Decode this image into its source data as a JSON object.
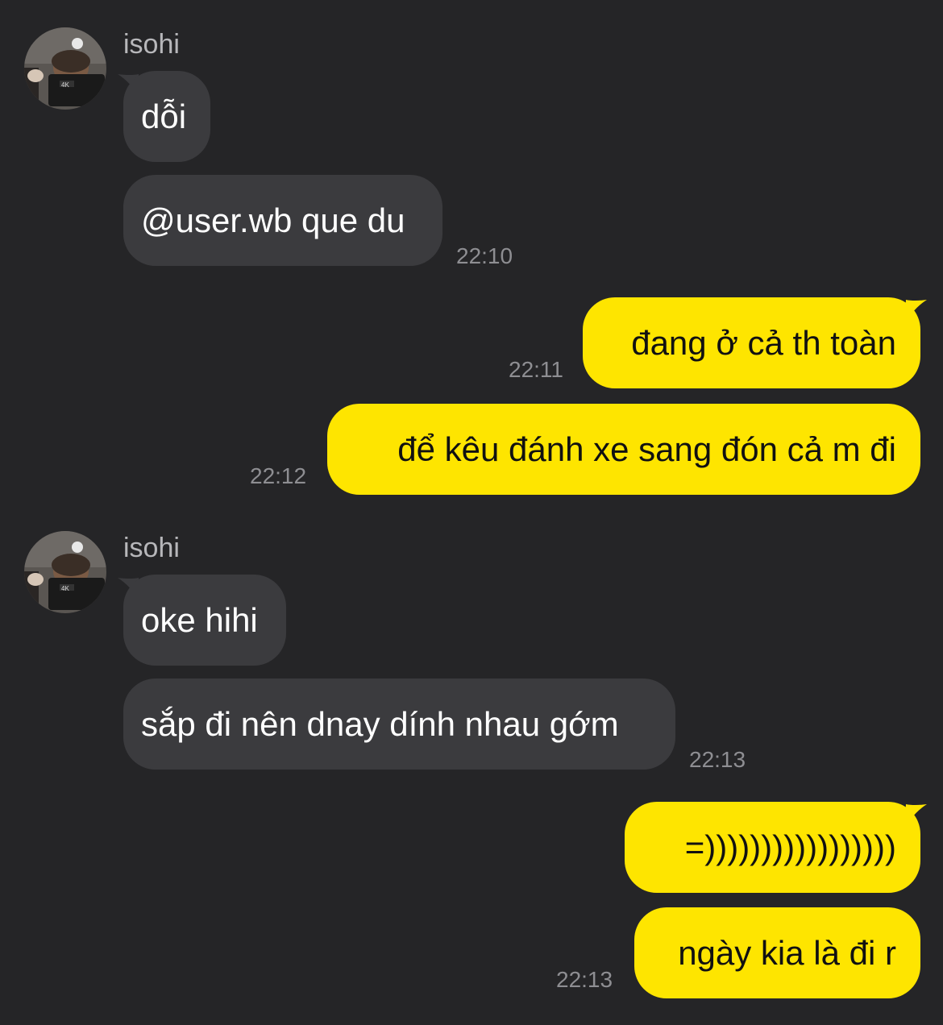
{
  "colors": {
    "background": "#252527",
    "incoming_bubble": "#3b3b3e",
    "outgoing_bubble": "#fee500",
    "timestamp": "#8e8e92",
    "sender_name": "#b7b7ba"
  },
  "messages": {
    "group1": {
      "sender": "isohi",
      "bubble1": "dỗi",
      "bubble2": "@user.wb que du",
      "time": "22:10"
    },
    "out1": {
      "text": "đang ở cả th toàn",
      "time": "22:11"
    },
    "out2": {
      "text": "để kêu đánh xe sang đón cả m đi",
      "time": "22:12"
    },
    "group2": {
      "sender": "isohi",
      "bubble1": "oke hihi",
      "bubble2": "sắp đi nên dnay dính nhau gớm",
      "time": "22:13"
    },
    "out3": {
      "text": "=)))))))))))))))))"
    },
    "out4": {
      "text": "ngày kia là đi r",
      "time": "22:13"
    }
  },
  "avatar": {
    "icon": "profile-photo"
  }
}
